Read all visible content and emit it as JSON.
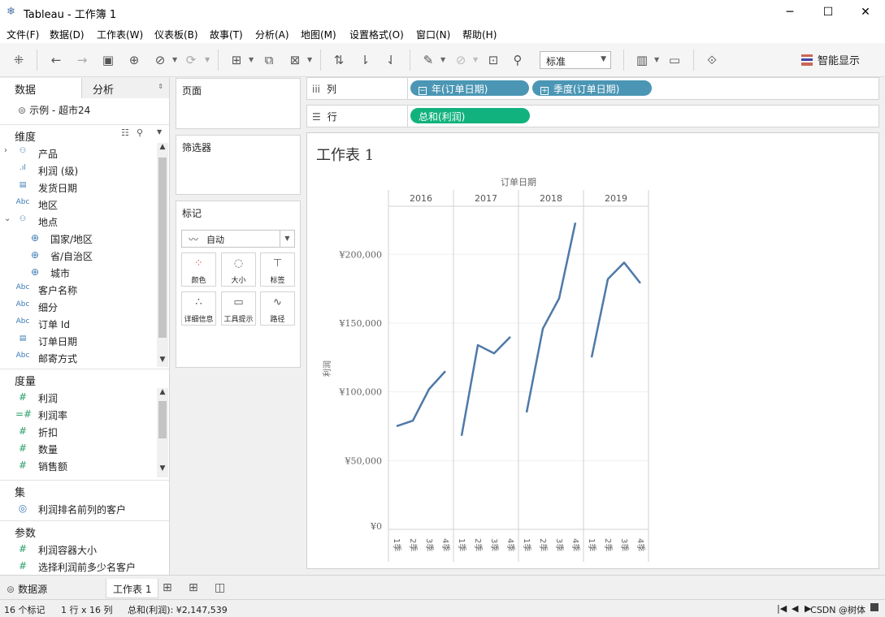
{
  "window": {
    "title": "Tableau - 工作簿 1",
    "minimize": "─",
    "maximize": "☐",
    "close": "✕"
  },
  "menu": [
    "文件(F)",
    "数据(D)",
    "工作表(W)",
    "仪表板(B)",
    "故事(T)",
    "分析(A)",
    "地图(M)",
    "设置格式(O)",
    "窗口(N)",
    "帮助(H)"
  ],
  "toolbar": {
    "fit_value": "标准",
    "show_me_label": "智能显示"
  },
  "left_pane": {
    "tab_data": "数据",
    "tab_analysis": "分析",
    "datasource": "示例 - 超市24",
    "dimensions_header": "维度",
    "dimensions": [
      {
        "icon": "hierarchy",
        "label": "产品",
        "expandable": "›"
      },
      {
        "icon": "bin",
        "label": "利润 (级)"
      },
      {
        "icon": "date",
        "label": "发货日期"
      },
      {
        "icon": "string",
        "label": "地区"
      },
      {
        "icon": "hierarchy",
        "label": "地点",
        "expanded": "⌄"
      },
      {
        "icon": "geo",
        "label": "国家/地区"
      },
      {
        "icon": "geo",
        "label": "省/自治区"
      },
      {
        "icon": "geo",
        "label": "城市"
      },
      {
        "icon": "string",
        "label": "客户名称"
      },
      {
        "icon": "string",
        "label": "细分"
      },
      {
        "icon": "string",
        "label": "订单 Id"
      },
      {
        "icon": "date",
        "label": "订单日期"
      },
      {
        "icon": "string",
        "label": "邮寄方式"
      }
    ],
    "measures_header": "度量",
    "measures": [
      "利润",
      "利润率",
      "折扣",
      "数量",
      "销售额"
    ],
    "sets_header": "集",
    "sets": [
      "利润排名前列的客户"
    ],
    "params_header": "参数",
    "params": [
      "利润容器大小",
      "选择利润前多少名客户"
    ],
    "abc": "Abc"
  },
  "cards": {
    "pages": "页面",
    "filters": "筛选器",
    "marks": "标记",
    "mark_type": "自动",
    "buttons": [
      "颜色",
      "大小",
      "标签",
      "详细信息",
      "工具提示",
      "路径"
    ]
  },
  "shelves": {
    "columns_label": "列",
    "rows_label": "行",
    "columns_pills": [
      "年(订单日期)",
      "季度(订单日期)"
    ],
    "rows_pills": [
      "总和(利润)"
    ]
  },
  "sheet_title": "工作表 1",
  "chart_data": {
    "type": "line",
    "x_header": "订单日期",
    "ylabel": "利润",
    "years": [
      "2016",
      "2017",
      "2018",
      "2019"
    ],
    "quarters": [
      "1季",
      "2季",
      "3季",
      "4季"
    ],
    "series": [
      {
        "name": "2016",
        "values": [
          75000,
          79000,
          102000,
          115000
        ]
      },
      {
        "name": "2017",
        "values": [
          68000,
          134000,
          128000,
          140000
        ]
      },
      {
        "name": "2018",
        "values": [
          85000,
          146000,
          168000,
          223000
        ]
      },
      {
        "name": "2019",
        "values": [
          125000,
          182000,
          194000,
          179000
        ]
      }
    ],
    "yticks": [
      "¥0",
      "¥50,000",
      "¥100,000",
      "¥150,000",
      "¥200,000"
    ],
    "ylim": [
      0,
      235000
    ],
    "line_color": "#4e79a7"
  },
  "bottom_tabs": {
    "datasource": "数据源",
    "sheet": "工作表 1"
  },
  "status": {
    "marks": "16 个标记",
    "rows_cols": "1 行 x 16 列",
    "sum": "总和(利润): ¥2,147,539",
    "watermark": "CSDN @树体"
  }
}
